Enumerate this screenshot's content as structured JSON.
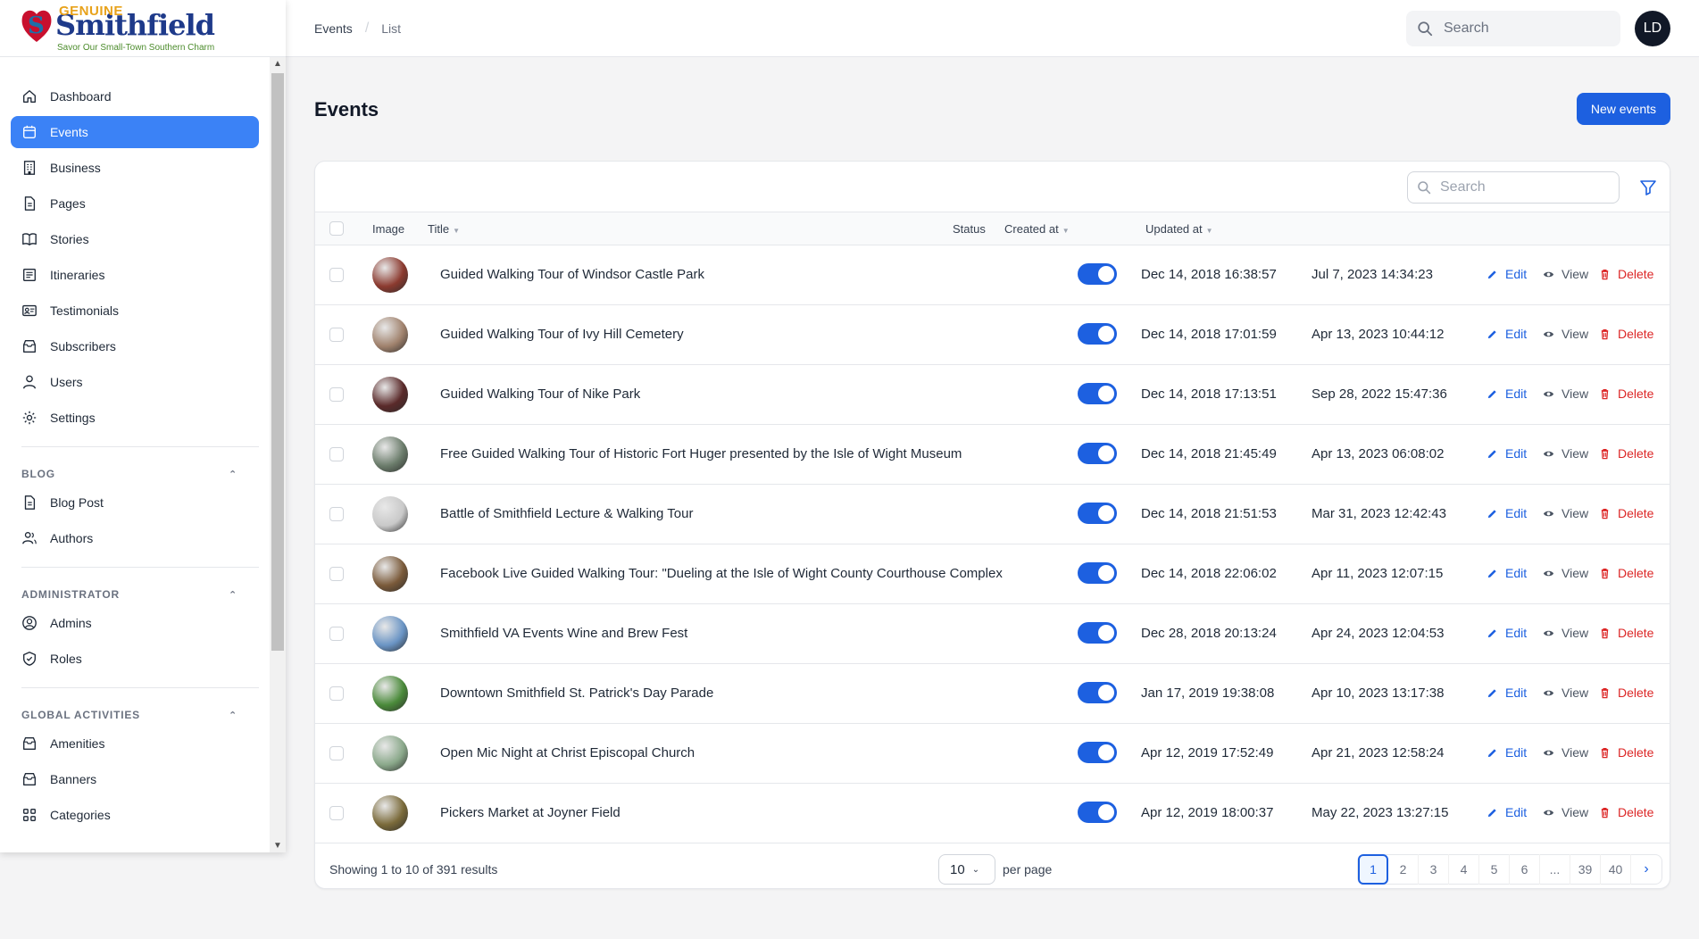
{
  "brand": {
    "top": "GENUINE",
    "main": "Smithfield",
    "tagline": "Savor Our Small-Town Southern Charm"
  },
  "sidebar": {
    "items": [
      {
        "label": "Dashboard",
        "icon": "home-icon"
      },
      {
        "label": "Events",
        "icon": "calendar-icon",
        "active": true
      },
      {
        "label": "Business",
        "icon": "building-icon"
      },
      {
        "label": "Pages",
        "icon": "document-icon"
      },
      {
        "label": "Stories",
        "icon": "book-icon"
      },
      {
        "label": "Itineraries",
        "icon": "list-icon"
      },
      {
        "label": "Testimonials",
        "icon": "id-card-icon"
      },
      {
        "label": "Subscribers",
        "icon": "inbox-icon"
      },
      {
        "label": "Users",
        "icon": "user-icon"
      },
      {
        "label": "Settings",
        "icon": "gear-icon"
      }
    ],
    "groups": [
      {
        "title": "BLOG",
        "items": [
          {
            "label": "Blog Post",
            "icon": "document-icon"
          },
          {
            "label": "Authors",
            "icon": "users-icon"
          }
        ]
      },
      {
        "title": "ADMINISTRATOR",
        "items": [
          {
            "label": "Admins",
            "icon": "user-circle-icon"
          },
          {
            "label": "Roles",
            "icon": "shield-icon"
          }
        ]
      },
      {
        "title": "GLOBAL ACTIVITIES",
        "items": [
          {
            "label": "Amenities",
            "icon": "inbox-icon"
          },
          {
            "label": "Banners",
            "icon": "inbox-icon"
          },
          {
            "label": "Categories",
            "icon": "grid-icon"
          }
        ]
      }
    ]
  },
  "topbar": {
    "breadcrumb": [
      "Events",
      "List"
    ],
    "search_placeholder": "Search",
    "avatar_initials": "LD"
  },
  "main": {
    "title": "Events",
    "new_button": "New events",
    "table_search_placeholder": "Search",
    "columns": {
      "image": "Image",
      "title": "Title",
      "status": "Status",
      "created": "Created at",
      "updated": "Updated at"
    },
    "actions": {
      "edit": "Edit",
      "view": "View",
      "delete": "Delete"
    },
    "rows": [
      {
        "title": "Guided Walking Tour of Windsor Castle Park",
        "status": true,
        "created": "Dec 14, 2018 16:38:57",
        "updated": "Jul 7, 2023 14:34:23",
        "thumb": "#8b3a2f"
      },
      {
        "title": "Guided Walking Tour of Ivy Hill Cemetery",
        "status": true,
        "created": "Dec 14, 2018 17:01:59",
        "updated": "Apr 13, 2023 10:44:12",
        "thumb": "#a0826d"
      },
      {
        "title": "Guided Walking Tour of Nike Park",
        "status": true,
        "created": "Dec 14, 2018 17:13:51",
        "updated": "Sep 28, 2022 15:47:36",
        "thumb": "#5a2a2a"
      },
      {
        "title": "Free Guided Walking Tour of Historic Fort Huger presented by the Isle of Wight Museum",
        "status": true,
        "created": "Dec 14, 2018 21:45:49",
        "updated": "Apr 13, 2023 06:08:02",
        "thumb": "#6b7c6b"
      },
      {
        "title": "Battle of Smithfield Lecture & Walking Tour",
        "status": true,
        "created": "Dec 14, 2018 21:51:53",
        "updated": "Mar 31, 2023 12:42:43",
        "thumb": "#c9c9c9"
      },
      {
        "title": "Facebook Live Guided Walking Tour: \"Dueling at the Isle of Wight County Courthouse Complex",
        "status": true,
        "created": "Dec 14, 2018 22:06:02",
        "updated": "Apr 11, 2023 12:07:15",
        "thumb": "#7a5a3a"
      },
      {
        "title": "Smithfield VA Events Wine and Brew Fest",
        "status": true,
        "created": "Dec 28, 2018 20:13:24",
        "updated": "Apr 24, 2023 12:04:53",
        "thumb": "#6a94c4"
      },
      {
        "title": "Downtown Smithfield St. Patrick's Day Parade",
        "status": true,
        "created": "Jan 17, 2019 19:38:08",
        "updated": "Apr 10, 2023 13:17:38",
        "thumb": "#4a8a3a"
      },
      {
        "title": "Open Mic Night at Christ Episcopal Church",
        "status": true,
        "created": "Apr 12, 2019 17:52:49",
        "updated": "Apr 21, 2023 12:58:24",
        "thumb": "#8aa88a"
      },
      {
        "title": "Pickers Market at Joyner Field",
        "status": true,
        "created": "Apr 12, 2019 18:00:37",
        "updated": "May 22, 2023 13:27:15",
        "thumb": "#7a6a3a"
      }
    ],
    "footer": {
      "showing": "Showing 1 to 10 of 391 results",
      "per_page_value": "10",
      "per_page_label": "per page",
      "pages": [
        "1",
        "2",
        "3",
        "4",
        "5",
        "6",
        "...",
        "39",
        "40"
      ],
      "current_page": "1"
    }
  }
}
